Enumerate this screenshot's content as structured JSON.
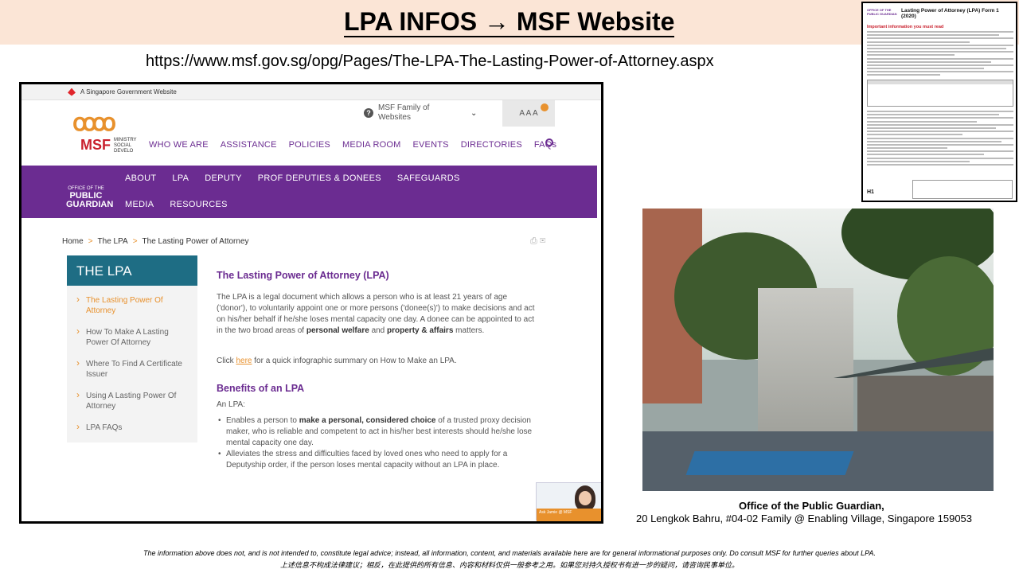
{
  "slide": {
    "title": "LPA INFOS → MSF Website",
    "url": "https://www.msf.gov.sg/opg/Pages/The-LPA-The-Lasting-Power-of-Attorney.aspx",
    "caption_title": "Office of the Public Guardian,",
    "caption_address": "20 Lengkok Bahru, #04-02 Family @ Enabling Village, Singapore 159053",
    "disclaimer_en": "The information above does not, and is not intended to, constitute legal advice; instead, all information, content, and materials available here are for general informational purposes only. Do consult MSF for further queries about LPA.",
    "disclaimer_zh": "上述信息不构成法律建议；相反，在此提供的所有信息、内容和材料仅供一般参考之用。如果您对持久授权书有进一步的疑问，请咨询民事单位。"
  },
  "site": {
    "gov_banner": "A Singapore Government Website",
    "logo_text": "MSF",
    "logo_sub": "MINISTRY SOCIAL DEVELO",
    "family_websites": "MSF Family of Websites",
    "font_sizes": "A A A",
    "main_nav": [
      "WHO WE ARE",
      "ASSISTANCE",
      "POLICIES",
      "MEDIA ROOM",
      "EVENTS",
      "DIRECTORIES",
      "FAQs"
    ],
    "opg_small": "OFFICE OF THE",
    "opg_big": "PUBLIC GUARDIAN",
    "sub_nav": [
      "ABOUT",
      "LPA",
      "DEPUTY",
      "PROF DEPUTIES & DONEES",
      "SAFEGUARDS",
      "MEDIA",
      "RESOURCES"
    ],
    "breadcrumb": [
      "Home",
      "The LPA",
      "The Lasting Power of Attorney"
    ],
    "sidebar_title": "THE LPA",
    "sidebar_items": [
      "The Lasting Power Of Attorney",
      "How To Make A Lasting Power Of Attorney",
      "Where To Find A Certificate Issuer",
      "Using A Lasting Power Of Attorney",
      "LPA FAQs"
    ],
    "content": {
      "heading": "The Lasting Power of Attorney (LPA)",
      "intro": "The LPA is a legal document which allows a person who is at least 21 years of age ('donor'), to voluntarily appoint one or more persons ('donee(s)') to make decisions and act on his/her behalf if he/she loses mental capacity one day. A donee can be appointed to act in the two broad areas of",
      "intro_b1": "personal welfare",
      "intro_and": "and",
      "intro_b2": "property & affairs",
      "intro_end": "matters.",
      "click": "Click",
      "here": "here",
      "click_rest": "for a quick infographic summary on How to Make an LPA.",
      "benefits_heading": "Benefits of an LPA",
      "an_lpa": "An LPA:",
      "b1_pre": "Enables a person to",
      "b1_bold": "make a personal, considered choice",
      "b1_post": "of a trusted proxy decision maker, who is reliable and competent to act in his/her best interests should he/she lose mental capacity one day.",
      "b2": "Alleviates the stress and difficulties faced by loved ones who need to apply for a Deputyship order, if the person loses mental capacity without an LPA in place."
    },
    "ask_jamie": "Ask Jamie @ MSF"
  },
  "form": {
    "office_label": "OFFICE OF THE PUBLIC GUARDIAN",
    "title": "Lasting Power of Attorney (LPA) Form 1 (2020)",
    "important": "Important information you must read",
    "tag": "H1"
  }
}
